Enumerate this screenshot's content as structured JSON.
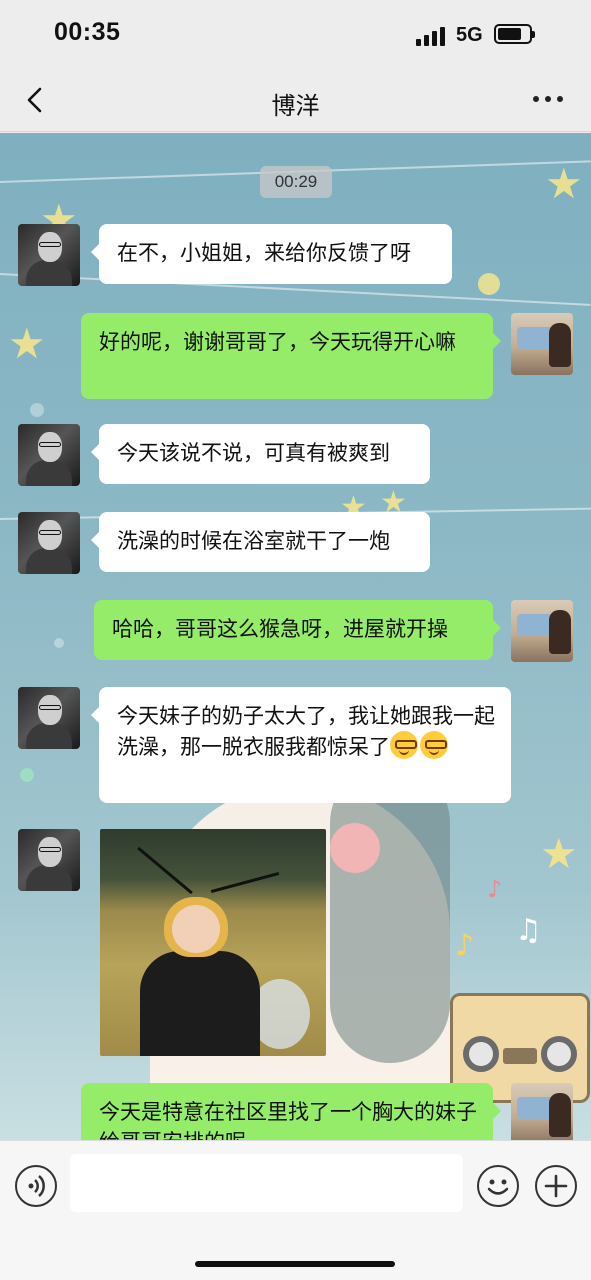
{
  "status_bar": {
    "time": "00:35",
    "network": "5G",
    "battery_level": 0.75
  },
  "header": {
    "title": "博洋",
    "back_icon": "chevron-left-icon",
    "more_icon": "ellipsis-icon"
  },
  "chat": {
    "timestamp": "00:29",
    "messages": [
      {
        "from": "contact",
        "type": "text",
        "text": "在不，小姐姐，来给你反馈了呀"
      },
      {
        "from": "me",
        "type": "text",
        "text": "好的呢，谢谢哥哥了，今天玩得开心嘛"
      },
      {
        "from": "contact",
        "type": "text",
        "text": "今天该说不说，可真有被爽到"
      },
      {
        "from": "contact",
        "type": "text",
        "text": "洗澡的时候在浴室就干了一炮"
      },
      {
        "from": "me",
        "type": "text",
        "text": "哈哈，哥哥这么猴急呀，进屋就开操"
      },
      {
        "from": "contact",
        "type": "text",
        "text": "今天妹子的奶子太大了，我让她跟我一起洗澡，那一脱衣服我都惊呆了",
        "emoji": "nerd-face-emoji"
      },
      {
        "from": "contact",
        "type": "image",
        "alt": "bee-costume-photo"
      },
      {
        "from": "me",
        "type": "text",
        "text": "今天是特意在社区里找了一个胸大的妹子给哥哥安排的呢"
      }
    ]
  },
  "input_bar": {
    "voice_icon": "voice-icon",
    "emoji_icon": "smiley-icon",
    "plus_icon": "plus-icon",
    "placeholder": ""
  },
  "colors": {
    "outgoing_bubble": "#95ec69",
    "incoming_bubble": "#ffffff",
    "chrome": "#ededed"
  }
}
